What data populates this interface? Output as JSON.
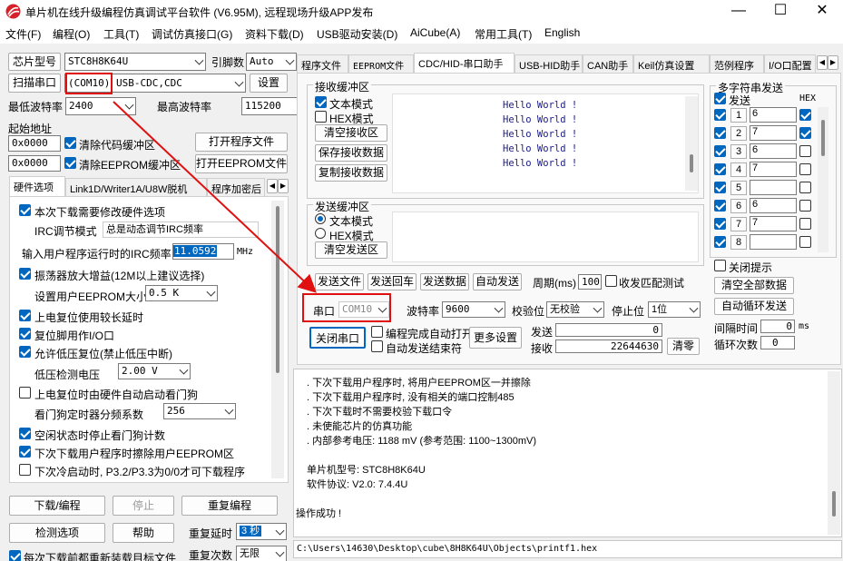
{
  "window": {
    "title": "单片机在线升级编程仿真调试平台软件 (V6.95M), 远程现场升级APP发布",
    "minimize": "—",
    "maximize": "☐",
    "close": "✕"
  },
  "menu": [
    "文件(F)",
    "编程(O)",
    "工具(T)",
    "调试仿真接口(G)",
    "资料下载(D)",
    "USB驱动安装(D)",
    "AiCube(A)",
    "常用工具(T)",
    "English"
  ],
  "left": {
    "chip_label": "芯片型号",
    "chip_value": "STC8H8K64U",
    "pin_label": "引脚数",
    "pin_value": "Auto",
    "scan_button": "扫描串口",
    "com_value": "(COM10)",
    "usb_value": "USB-CDC,CDC",
    "settings_button": "设置",
    "min_baud_label": "最低波特率",
    "min_baud_value": "2400",
    "max_baud_label": "最高波特率",
    "max_baud_value": "115200",
    "start_addr_label": "起始地址",
    "addr1": "0x0000",
    "clear_code_label": "清除代码缓冲区",
    "open_prog_button": "打开程序文件",
    "addr2": "0x0000",
    "clear_eeprom_label": "清除EEPROM缓冲区",
    "open_eeprom_button": "打开EEPROM文件",
    "tabs": [
      "硬件选项",
      "Link1D/Writer1A/U8W脱机",
      "程序加密后"
    ],
    "options": {
      "need_modify": "本次下载需要修改硬件选项",
      "irc_mode_label": "IRC调节模式",
      "irc_mode_value": "总是动态调节IRC频率",
      "irc_freq_label": "输入用户程序运行时的IRC频率",
      "irc_freq_value": "11.0592",
      "irc_unit": "MHz",
      "osc_gain": "振荡器放大增益(12M以上建议选择)",
      "eeprom_size_label": "设置用户EEPROM大小",
      "eeprom_size_value": "0.5 K",
      "power_reset": "上电复位使用较长延时",
      "reset_pin": "复位脚用作I/O口",
      "low_volt_reset": "允许低压复位(禁止低压中断)",
      "low_volt_label": "低压检测电压",
      "low_volt_value": "2.00 V",
      "wdt_auto": "上电复位时由硬件自动启动看门狗",
      "wdt_div_label": "看门狗定时器分频系数",
      "wdt_div_value": "256",
      "idle_wdt": "空闲状态时停止看门狗计数",
      "erase_eeprom": "下次下载用户程序时擦除用户EEPROM区",
      "cold_boot": "下次冷启动时, P3.2/P3.3为0/0才可下载程序"
    },
    "download_button": "下载/编程",
    "stop_button": "停止",
    "reprogram_button": "重复编程",
    "check_button": "检测选项",
    "help_button": "帮助",
    "repeat_delay_label": "重复延时",
    "repeat_delay_value": "3 秒",
    "reload_label": "每次下载前都重新装载目标文件",
    "repeat_count_label": "重复次数",
    "repeat_count_value": "无限"
  },
  "right_tabs": [
    "程序文件",
    "EEPROM文件",
    "CDC/HID-串口助手",
    "USB-HID助手",
    "CAN助手",
    "Keil仿真设置",
    "范例程序",
    "I/O口配置"
  ],
  "receive": {
    "group": "接收缓冲区",
    "text_mode": "文本模式",
    "hex_mode": "HEX模式",
    "clear": "清空接收区",
    "save": "保存接收数据",
    "copy": "复制接收数据",
    "lines": [
      "Hello World !",
      "Hello World !",
      "Hello World !",
      "Hello World !",
      "Hello World !"
    ]
  },
  "send": {
    "group": "发送缓冲区",
    "text_mode": "文本模式",
    "hex_mode": "HEX模式",
    "clear": "清空发送区",
    "send_file": "发送文件",
    "send_return": "发送回车",
    "send_data": "发送数据",
    "auto_send": "自动发送",
    "period_label": "周期(ms)",
    "period_value": "100",
    "loopback": "收发匹配测试"
  },
  "serial": {
    "port_label": "串口",
    "port_value": "COM10",
    "baud_label": "波特率",
    "baud_value": "9600",
    "parity_label": "校验位",
    "parity_value": "无校验",
    "stop_label": "停止位",
    "stop_value": "1位",
    "close_button": "关闭串口",
    "auto_open": "编程完成自动打开",
    "auto_end": "自动发送结束符",
    "more_button": "更多设置",
    "send_label": "发送",
    "send_count": "0",
    "recv_label": "接收",
    "recv_count": "22644630",
    "clear_button": "清零"
  },
  "multi": {
    "group": "多字符串发送",
    "send_header": "发送",
    "hex_header": "HEX",
    "rows": [
      {
        "n": "1",
        "v": "6",
        "hex": true
      },
      {
        "n": "2",
        "v": "7",
        "hex": true
      },
      {
        "n": "3",
        "v": "6",
        "hex": false
      },
      {
        "n": "4",
        "v": "7",
        "hex": false
      },
      {
        "n": "5",
        "v": "",
        "hex": false
      },
      {
        "n": "6",
        "v": "6",
        "hex": false
      },
      {
        "n": "7",
        "v": "7",
        "hex": false
      },
      {
        "n": "8",
        "v": "",
        "hex": false
      }
    ],
    "close_tip": "关闭提示",
    "clear_all": "清空全部数据",
    "auto_loop": "自动循环发送",
    "interval_label": "间隔时间",
    "interval_value": "0",
    "interval_unit": "ms",
    "loop_label": "循环次数",
    "loop_value": "0"
  },
  "log": [
    ". 下次下载用户程序时, 将用户EEPROM区一并擦除",
    ". 下次下载用户程序时, 没有相关的端口控制485",
    ". 下次下载时不需要校验下载口令",
    ". 未使能芯片的仿真功能",
    ". 内部参考电压: 1188 mV (参考范围: 1100~1300mV)",
    "",
    "单片机型号: STC8H8K64U",
    "软件协议: V2.0: 7.4.4U",
    "",
    "操作成功 !"
  ],
  "status_path": "C:\\Users\\14630\\Desktop\\cube\\8H8K64U\\Objects\\printf1.hex",
  "colors": {
    "annotation": "#e01010",
    "accent": "#0067c0",
    "hello_text": "#1a1a8a",
    "freq_highlight": "#0067c0"
  }
}
